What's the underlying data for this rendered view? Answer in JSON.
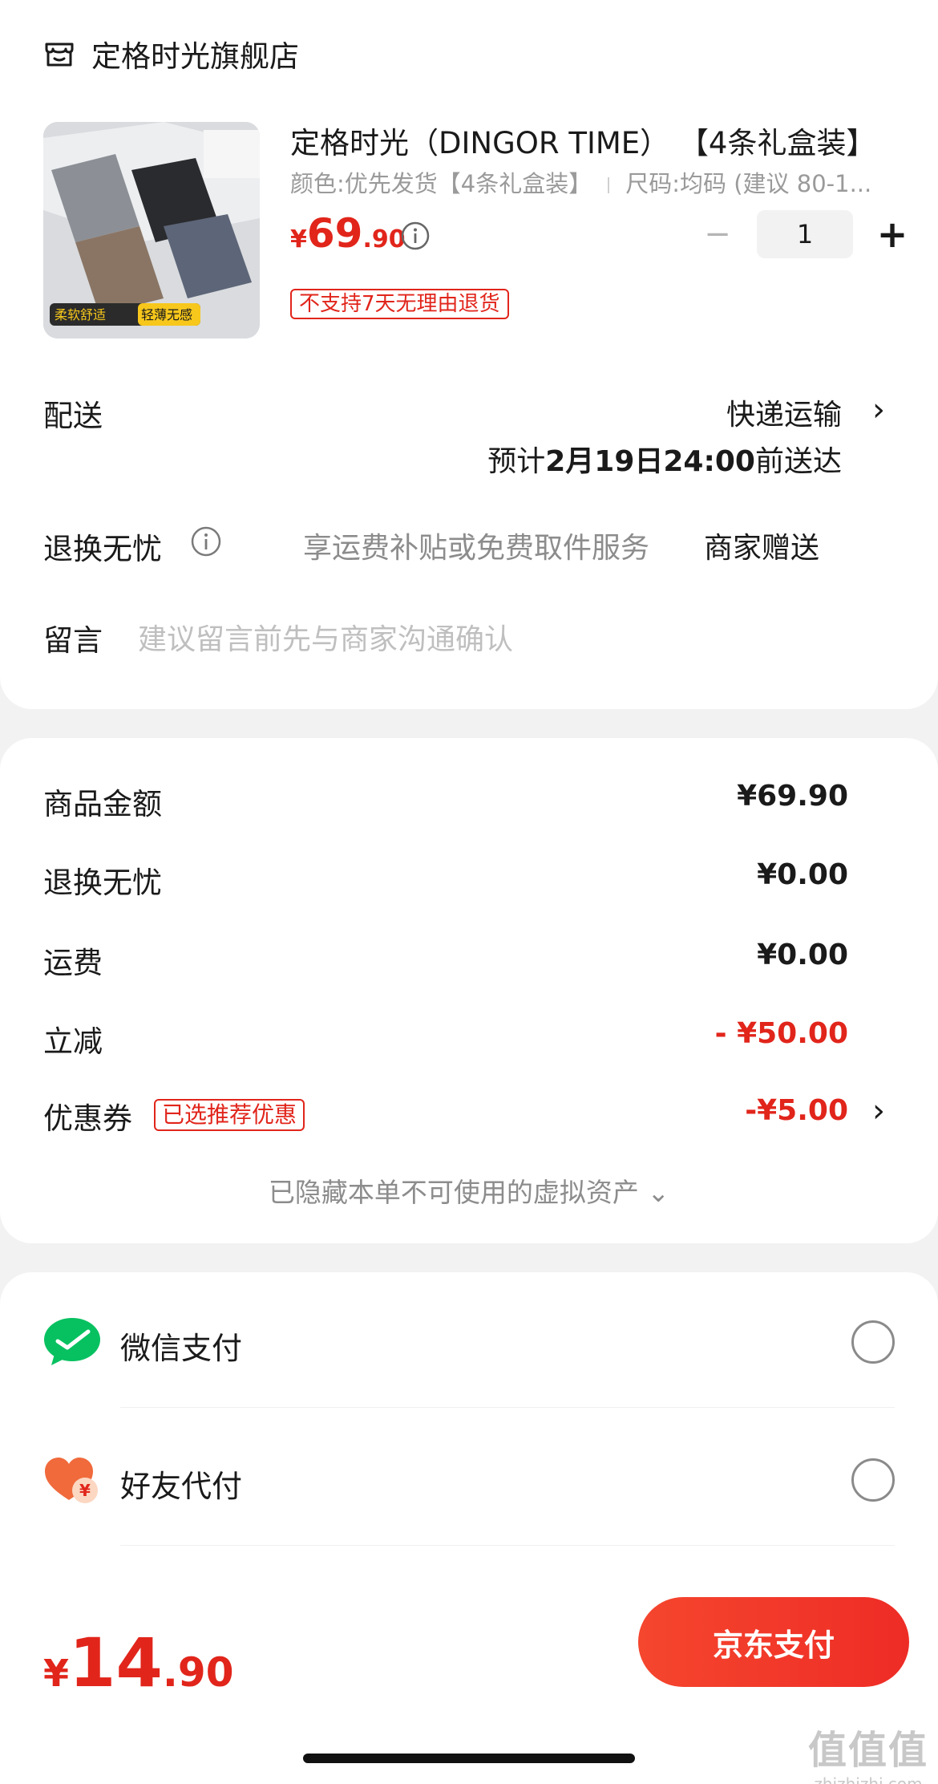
{
  "store": {
    "name": "定格时光旗舰店",
    "icon": "store-icon"
  },
  "product": {
    "title": "定格时光（DINGOR TIME） 【4条礼盒装】",
    "spec_color": "颜色:优先发货【4条礼盒装】",
    "spec_size": "尺码:均码 (建议 80-1...",
    "image_badge_left": "柔软舒适",
    "image_badge_right": "轻薄无感",
    "price_currency": "¥",
    "price_int": "69",
    "price_dec": ".90",
    "qty": "1",
    "qty_minus": "−",
    "qty_plus": "+",
    "return_notice": "不支持7天无理由退货"
  },
  "delivery": {
    "label": "配送",
    "method": "快递运输",
    "eta_prefix": "预计",
    "eta_date": "2月19日24:00",
    "eta_suffix": "前送达"
  },
  "return_service": {
    "label": "退换无忧",
    "desc": "享运费补贴或免费取件服务",
    "value": "商家赠送"
  },
  "message": {
    "label": "留言",
    "placeholder": "建议留言前先与商家沟通确认"
  },
  "breakdown": {
    "goods_label": "商品金额",
    "goods_value": "¥69.90",
    "return_label": "退换无忧",
    "return_value": "¥0.00",
    "shipping_label": "运费",
    "shipping_value": "¥0.00",
    "discount_label": "立减",
    "discount_value": "- ¥50.00",
    "coupon_label": "优惠券",
    "coupon_badge": "已选推荐优惠",
    "coupon_value": "-¥5.00",
    "hidden_assets": "已隐藏本单不可使用的虚拟资产 ⌄"
  },
  "payment": {
    "wechat_label": "微信支付",
    "friend_label": "好友代付"
  },
  "footer": {
    "total_currency": "¥",
    "total_int": "14",
    "total_dec": ".90",
    "pay_button": "京东支付"
  },
  "watermark": {
    "big": "值值值",
    "small": "zhizhizhi.com"
  },
  "colors": {
    "accent_red": "#e1251b",
    "wechat_green": "#07c160"
  }
}
